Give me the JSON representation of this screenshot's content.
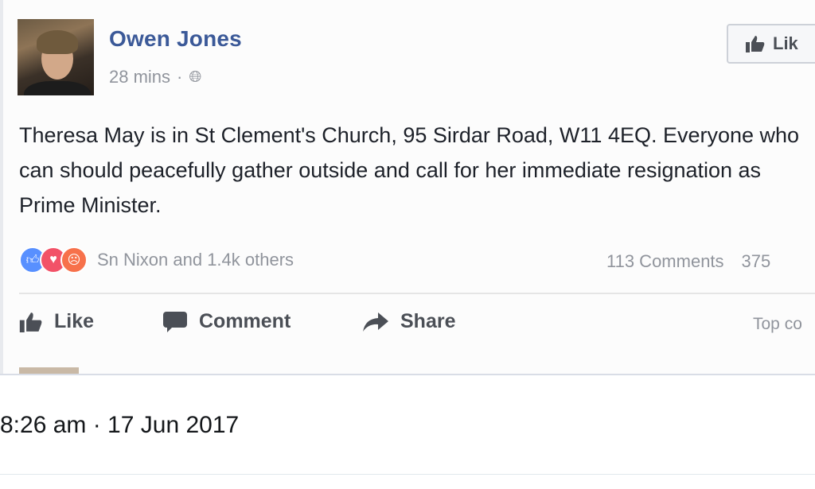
{
  "post": {
    "author": "Owen Jones",
    "time": "28 mins",
    "separator": "·",
    "text": "Theresa May is in St Clement's Church, 95 Sirdar Road, W11 4EQ. Everyone who can should peacefully gather outside and call for her immediate resignation as Prime Minister.",
    "page_like_label": "Lik",
    "reactions": {
      "icons": [
        "like-reaction",
        "love-reaction",
        "angry-reaction"
      ],
      "names": "Sn Nixon and 1.4k others"
    },
    "comments_count": "113 Comments",
    "shares_count": "375",
    "actions": {
      "like": "Like",
      "comment": "Comment",
      "share": "Share",
      "sort": "Top co"
    },
    "colors": {
      "author_link": "#3b5998",
      "like_reaction": "#5890ff",
      "love_reaction": "#f25268",
      "angry_reaction": "#f7714b"
    }
  },
  "tweet": {
    "timestamp": "8:26 am · 17 Jun 2017"
  }
}
